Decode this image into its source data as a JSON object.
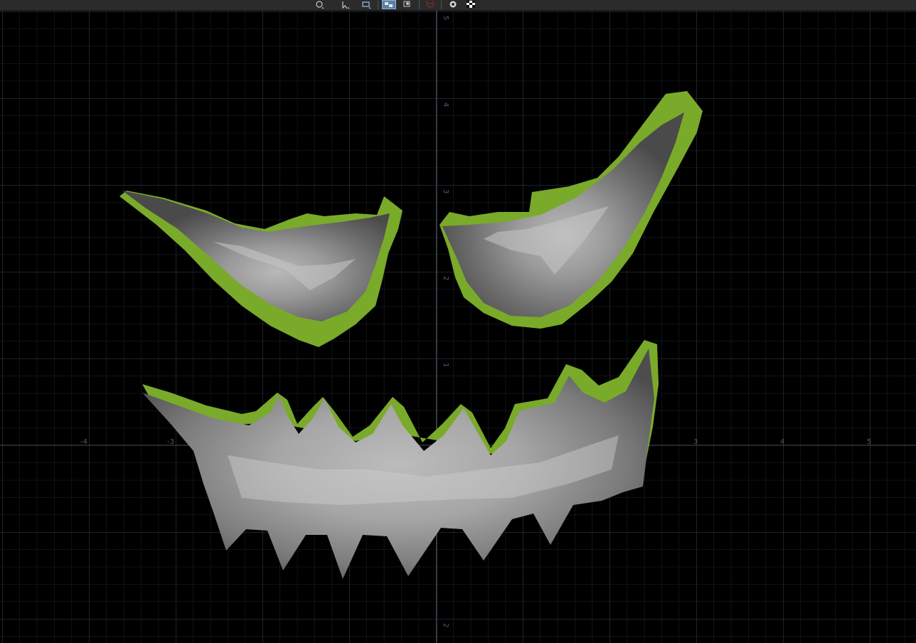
{
  "toolbar": {
    "buttons": [
      {
        "name": "orbit-tool-icon",
        "active": false
      },
      {
        "name": "select-tool-icon",
        "active": false
      },
      {
        "name": "transform-tool-icon",
        "active": false
      },
      {
        "name": "uv-shell-view-icon",
        "active": true
      },
      {
        "name": "zoom-frame-icon",
        "active": false
      },
      {
        "name": "no-entry-icon",
        "active": false
      },
      {
        "name": "settings-wheel-icon",
        "active": false
      },
      {
        "name": "checker-map-icon",
        "active": false
      }
    ]
  },
  "grid": {
    "x_labels": [
      "-4",
      "-3",
      "3",
      "4",
      "5"
    ],
    "y_labels": [
      "5",
      "4",
      "3",
      "2",
      "1",
      "2"
    ],
    "background": "#000000",
    "minor_line_color": "#1e242b",
    "major_line_color": "#3a4450"
  },
  "shells": {
    "highlight_color": "#7aaa2a",
    "fill_color": "#6f6f6f",
    "items": [
      {
        "name": "left-eye-shell"
      },
      {
        "name": "right-eye-shell"
      },
      {
        "name": "mouth-shell"
      }
    ]
  }
}
